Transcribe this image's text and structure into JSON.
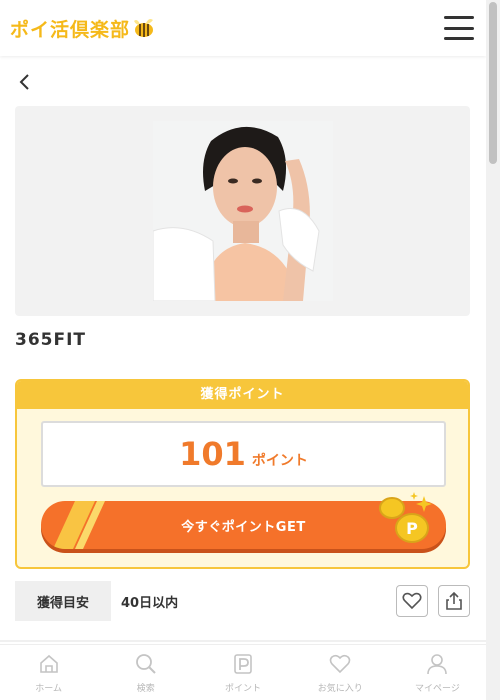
{
  "header": {
    "logo_text": "ポイ活倶楽部",
    "logo_icon": "bee-icon",
    "menu_icon": "hamburger-icon"
  },
  "detail": {
    "back_icon": "chevron-left-icon",
    "app_name": "365FIT"
  },
  "points": {
    "heading": "獲得ポイント",
    "value": "101",
    "unit": "ポイント",
    "cta_label": "今すぐポイントGET"
  },
  "estimate": {
    "label": "獲得目安",
    "value": "40日以内"
  },
  "actions": {
    "favorite_icon": "heart-icon",
    "share_icon": "share-icon"
  },
  "bottom_nav": [
    {
      "label": "ホーム",
      "icon": "home-icon"
    },
    {
      "label": "検索",
      "icon": "search-icon"
    },
    {
      "label": "ポイント",
      "icon": "point-icon"
    },
    {
      "label": "お気に入り",
      "icon": "heart-icon"
    },
    {
      "label": "マイページ",
      "icon": "user-icon"
    }
  ],
  "colors": {
    "accent": "#f5712a",
    "brand": "#f7c63b",
    "points_text": "#f07a2b"
  }
}
